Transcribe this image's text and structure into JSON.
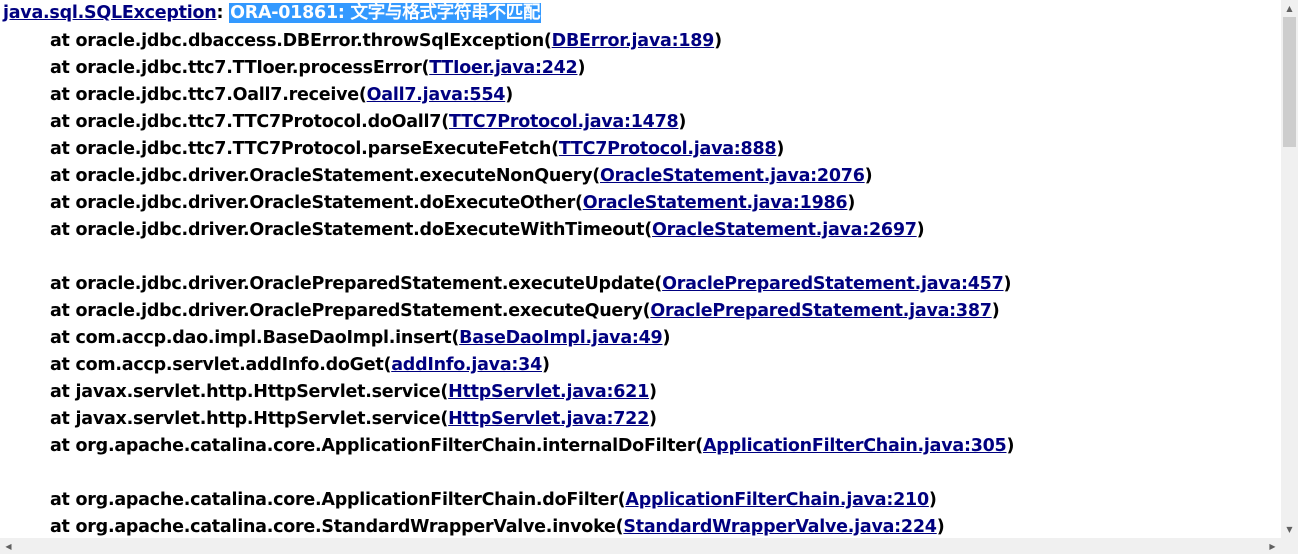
{
  "exception": {
    "class_link": "java.sql.SQLException",
    "separator": ": ",
    "message": "ORA-01861: 文字与格式字符串不匹配"
  },
  "frames": [
    {
      "method": "at oracle.jdbc.dbaccess.DBError.throwSqlException(",
      "source": "DBError.java:189",
      "close": ")"
    },
    {
      "method": "at oracle.jdbc.ttc7.TTIoer.processError(",
      "source": "TTIoer.java:242",
      "close": ")"
    },
    {
      "method": "at oracle.jdbc.ttc7.Oall7.receive(",
      "source": "Oall7.java:554",
      "close": ")"
    },
    {
      "method": "at oracle.jdbc.ttc7.TTC7Protocol.doOall7(",
      "source": "TTC7Protocol.java:1478",
      "close": ")"
    },
    {
      "method": "at oracle.jdbc.ttc7.TTC7Protocol.parseExecuteFetch(",
      "source": "TTC7Protocol.java:888",
      "close": ")"
    },
    {
      "method": "at oracle.jdbc.driver.OracleStatement.executeNonQuery(",
      "source": "OracleStatement.java:2076",
      "close": ")"
    },
    {
      "method": "at oracle.jdbc.driver.OracleStatement.doExecuteOther(",
      "source": "OracleStatement.java:1986",
      "close": ")"
    },
    {
      "method": "at oracle.jdbc.driver.OracleStatement.doExecuteWithTimeout(",
      "source": "OracleStatement.java:2697",
      "close": ")"
    },
    {
      "method": "at oracle.jdbc.driver.OraclePreparedStatement.executeUpdate(",
      "source": "OraclePreparedStatement.java:457",
      "close": ")"
    },
    {
      "method": "at oracle.jdbc.driver.OraclePreparedStatement.executeQuery(",
      "source": "OraclePreparedStatement.java:387",
      "close": ")"
    },
    {
      "method": "at com.accp.dao.impl.BaseDaoImpl.insert(",
      "source": "BaseDaoImpl.java:49",
      "close": ")"
    },
    {
      "method": "at com.accp.servlet.addInfo.doGet(",
      "source": "addInfo.java:34",
      "close": ")"
    },
    {
      "method": "at javax.servlet.http.HttpServlet.service(",
      "source": "HttpServlet.java:621",
      "close": ")"
    },
    {
      "method": "at javax.servlet.http.HttpServlet.service(",
      "source": "HttpServlet.java:722",
      "close": ")"
    },
    {
      "method": "at org.apache.catalina.core.ApplicationFilterChain.internalDoFilter(",
      "source": "ApplicationFilterChain.java:305",
      "close": ")"
    },
    {
      "method": "at org.apache.catalina.core.ApplicationFilterChain.doFilter(",
      "source": "ApplicationFilterChain.java:210",
      "close": ")"
    },
    {
      "method": "at org.apache.catalina.core.StandardWrapperValve.invoke(",
      "source": "StandardWrapperValve.java:224",
      "close": ")"
    }
  ],
  "scrollbar": {
    "up_icon": "▲",
    "down_icon": "▼",
    "left_icon": "◀",
    "right_icon": "▶"
  },
  "colors": {
    "link": "#000080",
    "highlight_bg": "#3399ff",
    "highlight_text": "#ffffff"
  }
}
